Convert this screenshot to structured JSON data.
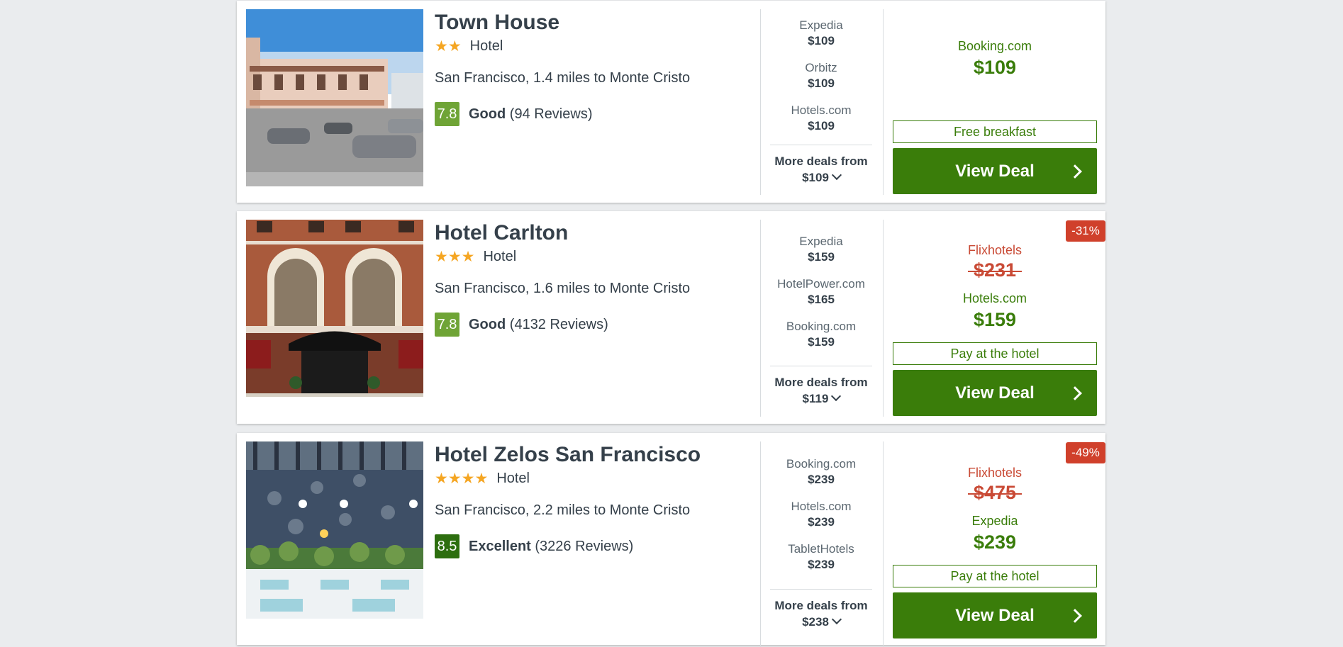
{
  "hotels": [
    {
      "name": "Town House",
      "stars": "★★",
      "type": "Hotel",
      "location": "San Francisco, 1.4 miles to Monte Cristo",
      "score": "7.8",
      "score_color": "#6fa436",
      "rating_word": "Good",
      "reviews": "(94 Reviews)",
      "deals": [
        {
          "site": "Expedia",
          "price": "$109"
        },
        {
          "site": "Orbitz",
          "price": "$109"
        },
        {
          "site": "Hotels.com",
          "price": "$109"
        }
      ],
      "more_label": "More deals from",
      "more_price": "$109",
      "best_site": "Booking.com",
      "best_price": "$109",
      "perk": "Free breakfast",
      "button": "View Deal"
    },
    {
      "name": "Hotel Carlton",
      "stars": "★★★",
      "type": "Hotel",
      "location": "San Francisco, 1.6 miles to Monte Cristo",
      "score": "7.8",
      "score_color": "#6fa436",
      "rating_word": "Good",
      "reviews": "(4132 Reviews)",
      "deals": [
        {
          "site": "Expedia",
          "price": "$159"
        },
        {
          "site": "HotelPower.com",
          "price": "$165"
        },
        {
          "site": "Booking.com",
          "price": "$159"
        }
      ],
      "more_label": "More deals from",
      "more_price": "$119",
      "badge": "-31%",
      "strike_site": "Flixhotels",
      "strike_price": "$231",
      "best_site": "Hotels.com",
      "best_price": "$159",
      "perk": "Pay at the hotel",
      "button": "View Deal"
    },
    {
      "name": "Hotel Zelos San Francisco",
      "stars": "★★★★",
      "type": "Hotel",
      "location": "San Francisco, 2.2 miles to Monte Cristo",
      "score": "8.5",
      "score_color": "#2d6e0f",
      "rating_word": "Excellent",
      "reviews": "(3226 Reviews)",
      "deals": [
        {
          "site": "Booking.com",
          "price": "$239"
        },
        {
          "site": "Hotels.com",
          "price": "$239"
        },
        {
          "site": "TabletHotels",
          "price": "$239"
        }
      ],
      "more_label": "More deals from",
      "more_price": "$238",
      "badge": "-49%",
      "strike_site": "Flixhotels",
      "strike_price": "$475",
      "best_site": "Expedia",
      "best_price": "$239",
      "perk": "Pay at the hotel",
      "button": "View Deal"
    }
  ]
}
